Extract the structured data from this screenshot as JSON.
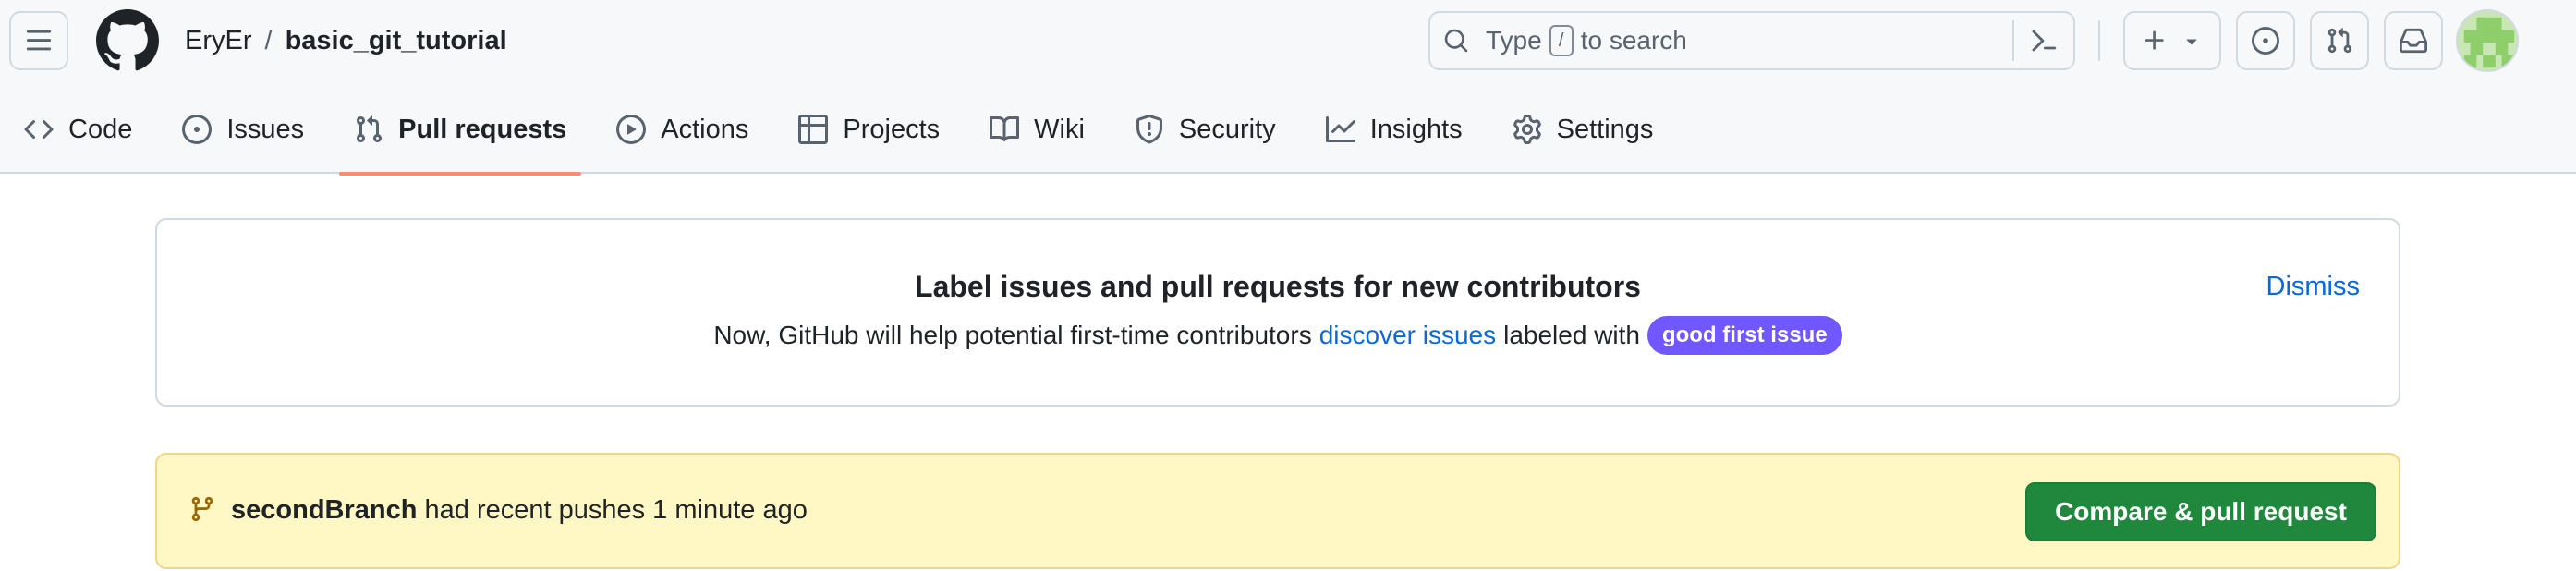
{
  "breadcrumb": {
    "owner": "EryEr",
    "separator": "/",
    "repo": "basic_git_tutorial"
  },
  "search": {
    "prefix": "Type",
    "key": "/",
    "suffix": "to search"
  },
  "tabs": [
    {
      "label": "Code",
      "icon": "code-icon",
      "selected": false
    },
    {
      "label": "Issues",
      "icon": "issue-opened-icon",
      "selected": false
    },
    {
      "label": "Pull requests",
      "icon": "git-pull-request-icon",
      "selected": true
    },
    {
      "label": "Actions",
      "icon": "play-icon",
      "selected": false
    },
    {
      "label": "Projects",
      "icon": "table-icon",
      "selected": false
    },
    {
      "label": "Wiki",
      "icon": "book-icon",
      "selected": false
    },
    {
      "label": "Security",
      "icon": "shield-icon",
      "selected": false
    },
    {
      "label": "Insights",
      "icon": "graph-icon",
      "selected": false
    },
    {
      "label": "Settings",
      "icon": "gear-icon",
      "selected": false
    }
  ],
  "banner": {
    "title": "Label issues and pull requests for new contributors",
    "text_before": "Now, GitHub will help potential first-time contributors",
    "link": "discover issues",
    "text_after": "labeled with",
    "label": "good first issue",
    "dismiss": "Dismiss"
  },
  "push_bar": {
    "branch": "secondBranch",
    "message": "had recent pushes 1 minute ago",
    "button": "Compare & pull request"
  },
  "colors": {
    "accent_underline": "#fd8c73",
    "link": "#0969da",
    "label_bg": "#7057ff",
    "push_bg": "#fff8c5",
    "primary_button": "#1f883d"
  }
}
